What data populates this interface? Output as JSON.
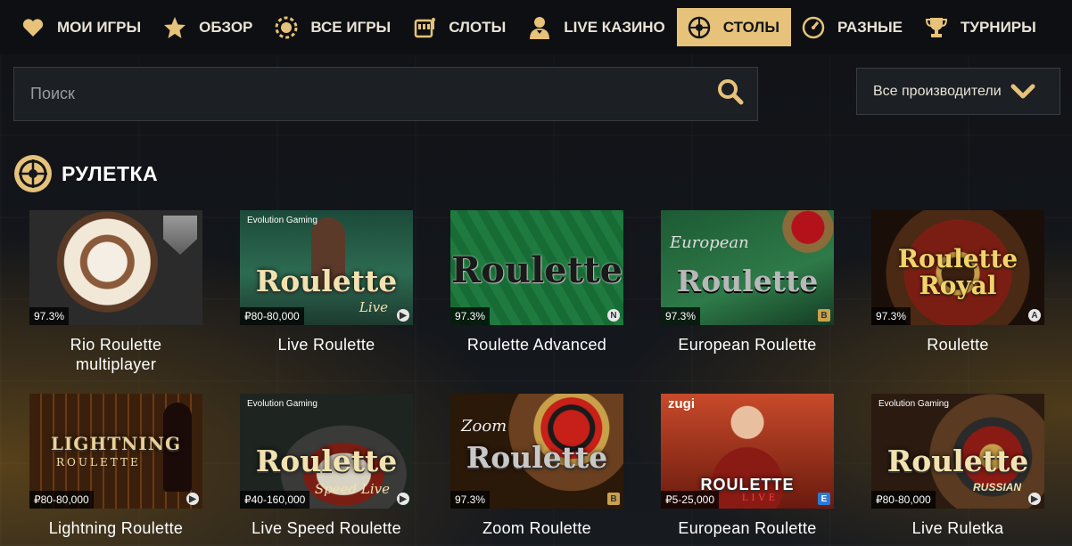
{
  "nav": [
    {
      "label": "МОИ ИГРЫ",
      "icon": "heart-icon",
      "active": false
    },
    {
      "label": "ОБЗОР",
      "icon": "star-icon",
      "active": false
    },
    {
      "label": "ВСЕ ИГРЫ",
      "icon": "chip-icon",
      "active": false
    },
    {
      "label": "СЛОТЫ",
      "icon": "slot-machine-icon",
      "active": false
    },
    {
      "label": "LIVE КАЗИНО",
      "icon": "dealer-icon",
      "active": false
    },
    {
      "label": "СТОЛЫ",
      "icon": "roulette-icon",
      "active": true
    },
    {
      "label": "РАЗНЫЕ",
      "icon": "gauge-icon",
      "active": false
    },
    {
      "label": "ТУРНИРЫ",
      "icon": "trophy-icon",
      "active": false
    }
  ],
  "search": {
    "placeholder": "Поиск",
    "value": ""
  },
  "providers": {
    "label": "Все производители"
  },
  "section": {
    "title": "РУЛЕТКА"
  },
  "colors": {
    "accent": "#e6c27a",
    "topbar": "#0d0f12",
    "field": "#1c1f24"
  },
  "games": [
    {
      "name": "Rio Roulette multiplayer",
      "badge": "97.3%",
      "thumb_text": "",
      "thumb_sub": "",
      "brand": "",
      "corner": ""
    },
    {
      "name": "Live Roulette",
      "badge": "₽80-80,000",
      "thumb_text": "Roulette",
      "thumb_sub": "Live",
      "brand": "Evolution Gaming",
      "corner": "▶"
    },
    {
      "name": "Roulette Advanced",
      "badge": "97.3%",
      "thumb_text": "Roulette",
      "thumb_sub": "",
      "brand": "",
      "corner": "N"
    },
    {
      "name": "European Roulette",
      "badge": "97.3%",
      "thumb_text": "Roulette",
      "thumb_sub": "European",
      "brand": "",
      "corner": "B"
    },
    {
      "name": "Roulette",
      "badge": "97.3%",
      "thumb_text": "Roulette Royal",
      "thumb_sub": "",
      "brand": "",
      "corner": "A"
    },
    {
      "name": "Lightning Roulette",
      "badge": "₽80-80,000",
      "thumb_text": "LIGHTNING",
      "thumb_sub": "ROULETTE",
      "brand": "",
      "corner": "▶"
    },
    {
      "name": "Live Speed Roulette",
      "badge": "₽40-160,000",
      "thumb_text": "Roulette",
      "thumb_sub": "Speed Live",
      "brand": "Evolution Gaming",
      "corner": "▶"
    },
    {
      "name": "Zoom Roulette",
      "badge": "97.3%",
      "thumb_text": "Roulette",
      "thumb_sub": "Zoom",
      "brand": "",
      "corner": "B"
    },
    {
      "name": "European Roulette",
      "badge": "₽5-25,000",
      "thumb_text": "ROULETTE",
      "thumb_sub": "LIVE",
      "brand": "zugi",
      "corner": "E"
    },
    {
      "name": "Live Ruletka",
      "badge": "₽80-80,000",
      "thumb_text": "Roulette",
      "thumb_sub": "RUSSIAN",
      "brand": "Evolution Gaming",
      "corner": "▶"
    }
  ]
}
